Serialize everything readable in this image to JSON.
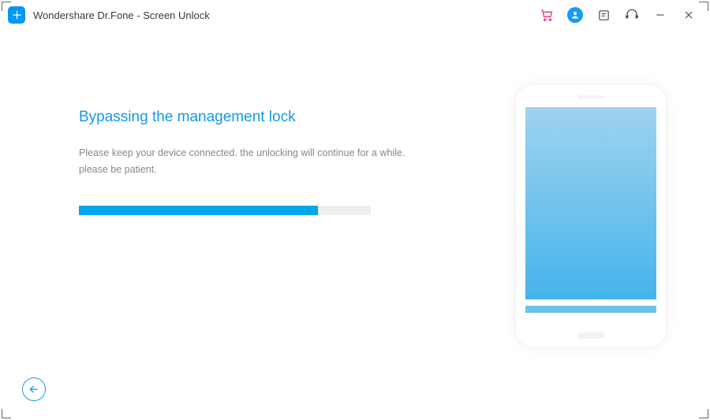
{
  "titlebar": {
    "app_title": "Wondershare Dr.Fone - Screen Unlock"
  },
  "main": {
    "heading": "Bypassing the management lock",
    "subtext_line1": "Please keep your device connected. the unlocking will continue for a while.",
    "subtext_line2": "please be patient.",
    "progress_percent": 82
  },
  "colors": {
    "accent": "#159cf6",
    "progress": "#00a6e8"
  }
}
